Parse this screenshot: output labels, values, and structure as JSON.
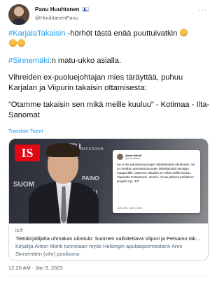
{
  "author": {
    "display_name": "Panu Huuhtanen",
    "handle": "@HuuhtanenPanu",
    "flag_icon": "finland-flag-icon",
    "avatar_icon": "avatar"
  },
  "more_icon": "ellipsis-icon",
  "tweet": {
    "line1": {
      "hashtag": "#KarjalaTakaisin",
      "text": " -hörhöt tästä enää puuttuivatkin"
    },
    "line2": {
      "hashtag": "#Sinnemäki",
      "text": ":n matu-ukko asialla."
    },
    "line3": "Vihreiden ex-puoluejohtajan mies täräyttää, puhuu Karjalan ja Viipurin takaisin ottamisesta:",
    "line4": "”Otamme takaisin sen mikä meille kuuluu” - Kotimaa - Ilta-Sanomat",
    "translate_label": "Translate Tweet"
  },
  "card": {
    "image": {
      "logo": "IS",
      "backdrop_texts": [
        "UTU",
        "SUOM",
        "PAINO",
        "ULPU"
      ],
      "backroom_label": "BACKROOM",
      "embedded_tweet": {
        "name": "Anton Monti",
        "handle": "@AntonMonti",
        "body": "Se ei ole panssarivaunujen lähettämistä Ukrainaan. Se on meidän panssarivaunujen lähettämistä Venäjän maaperälle. Otamme takaisin se mikä meille kuuluu. Viipurista Petsamoon. Suomi. Ainoa järkevä poliittinen projekti nyt. 3/3",
        "time": "12:03 AM · Jan 9, 2023"
      }
    },
    "domain": "is.fi",
    "title": "Tietokirjailijalta uhmakas ulostulo: Suomen valloitettava Viipuri ja Petsamo tak...",
    "description": "Kirjailija Anton Monti tunnetaan myös Helsingin apulaispormestarin Anni Sinnemäen (vihr) puolisona."
  },
  "timestamp": "12:20 AM · Jan 9, 2023",
  "colors": {
    "accent": "#1d9bf0",
    "text": "#0f1419",
    "muted": "#536471",
    "border": "#cfd9de",
    "brand_is": "#e30613"
  }
}
